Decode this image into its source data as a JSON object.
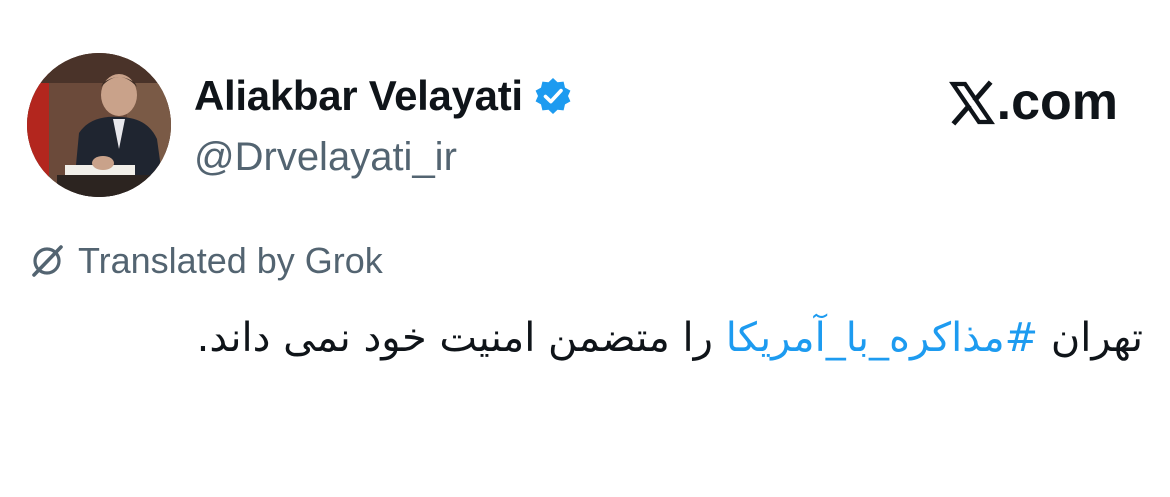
{
  "author": {
    "display_name": "Aliakbar Velayati",
    "handle": "@Drvelayati_ir",
    "verified": true,
    "avatar_icon": "profile-photo"
  },
  "brand": {
    "logo_icon": "x-logo-icon",
    "label": ".com"
  },
  "translation": {
    "icon": "grok-icon",
    "label": "Translated by Grok"
  },
  "tweet": {
    "text_before": "تهران ",
    "hashtag": "#مذاکره_با_آمریکا",
    "text_after": " را متضمن امنیت خود نمی داند."
  },
  "colors": {
    "text": "#0f1419",
    "secondary": "#536471",
    "link": "#1d9bf0",
    "verified": "#1d9bf0"
  }
}
